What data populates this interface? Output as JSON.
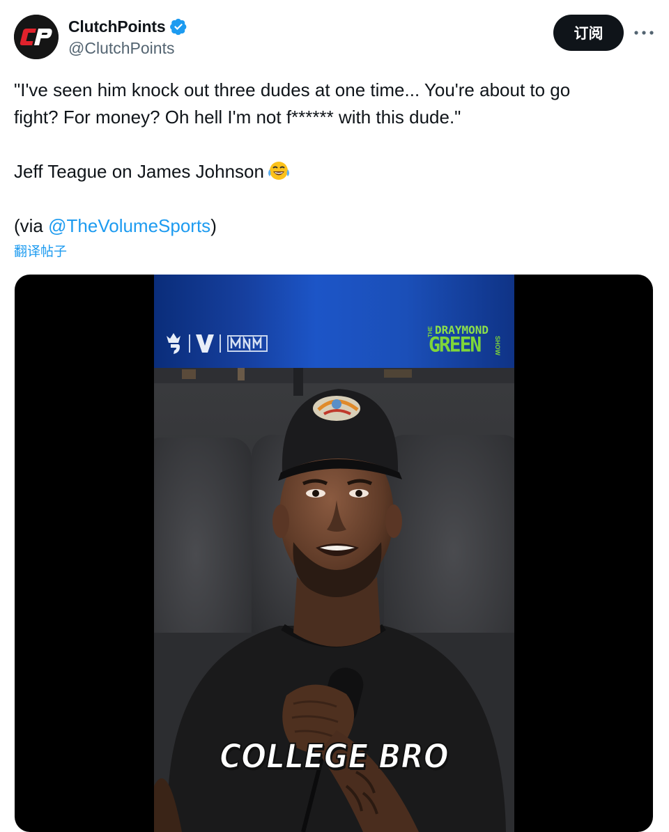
{
  "tweet": {
    "author": {
      "display_name": "ClutchPoints",
      "handle": "@ClutchPoints",
      "verified": true,
      "avatar_text": "CP"
    },
    "subscribe_label": "订阅",
    "more_icon": "more-horizontal-icon",
    "text": {
      "line1": "\"I've seen him knock out three dudes at one time... You're about to go",
      "line2": "fight? For money? Oh hell I'm not f****** with this dude.\"",
      "line3": "Jeff Teague on James Johnson",
      "emoji": "😂",
      "via_prefix": "(via ",
      "via_mention": "@TheVolumeSports",
      "via_suffix": ")"
    },
    "translate_label": "翻译帖子"
  },
  "media": {
    "type": "video",
    "overlay_logos": {
      "left_marks": [
        "V",
        "NM"
      ],
      "show_logo_the": "THE",
      "show_logo_line1": "DRAYMOND",
      "show_logo_line2": "GREEN",
      "show_logo_show": "SHOW"
    },
    "caption": "COLLEGE BRO"
  },
  "colors": {
    "link": "#1d9bf0",
    "text": "#0f1419",
    "muted": "#536471",
    "banner_blue": "#1c55c7",
    "show_logo_green": "#7fd63a"
  }
}
